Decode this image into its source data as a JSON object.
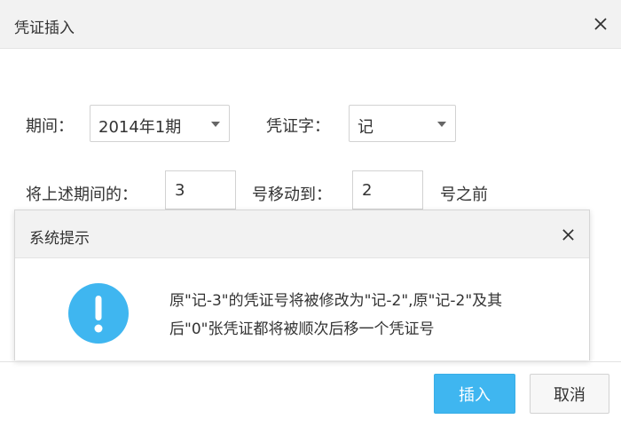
{
  "dialog": {
    "title": "凭证插入",
    "period_label": "期间：",
    "period_value": "2014年1期",
    "voucher_word_label": "凭证字：",
    "voucher_word_value": "记",
    "move_prefix": "将上述期间的：",
    "move_from_value": "3",
    "move_middle": "号移动到：",
    "move_to_value": "2",
    "move_suffix": "号之前",
    "insert_button": "插入",
    "cancel_button": "取消"
  },
  "message": {
    "title": "系统提示",
    "line1": "原\"记-3\"的凭证号将被修改为\"记-2\",原\"记-2\"及其",
    "line2": "后\"0\"张凭证都将被顺次后移一个凭证号",
    "icon": "info-exclamation-icon",
    "icon_color": "#3fb6f0"
  },
  "colors": {
    "primary": "#3fb6f0",
    "titlebar": "#f2f2f2"
  }
}
